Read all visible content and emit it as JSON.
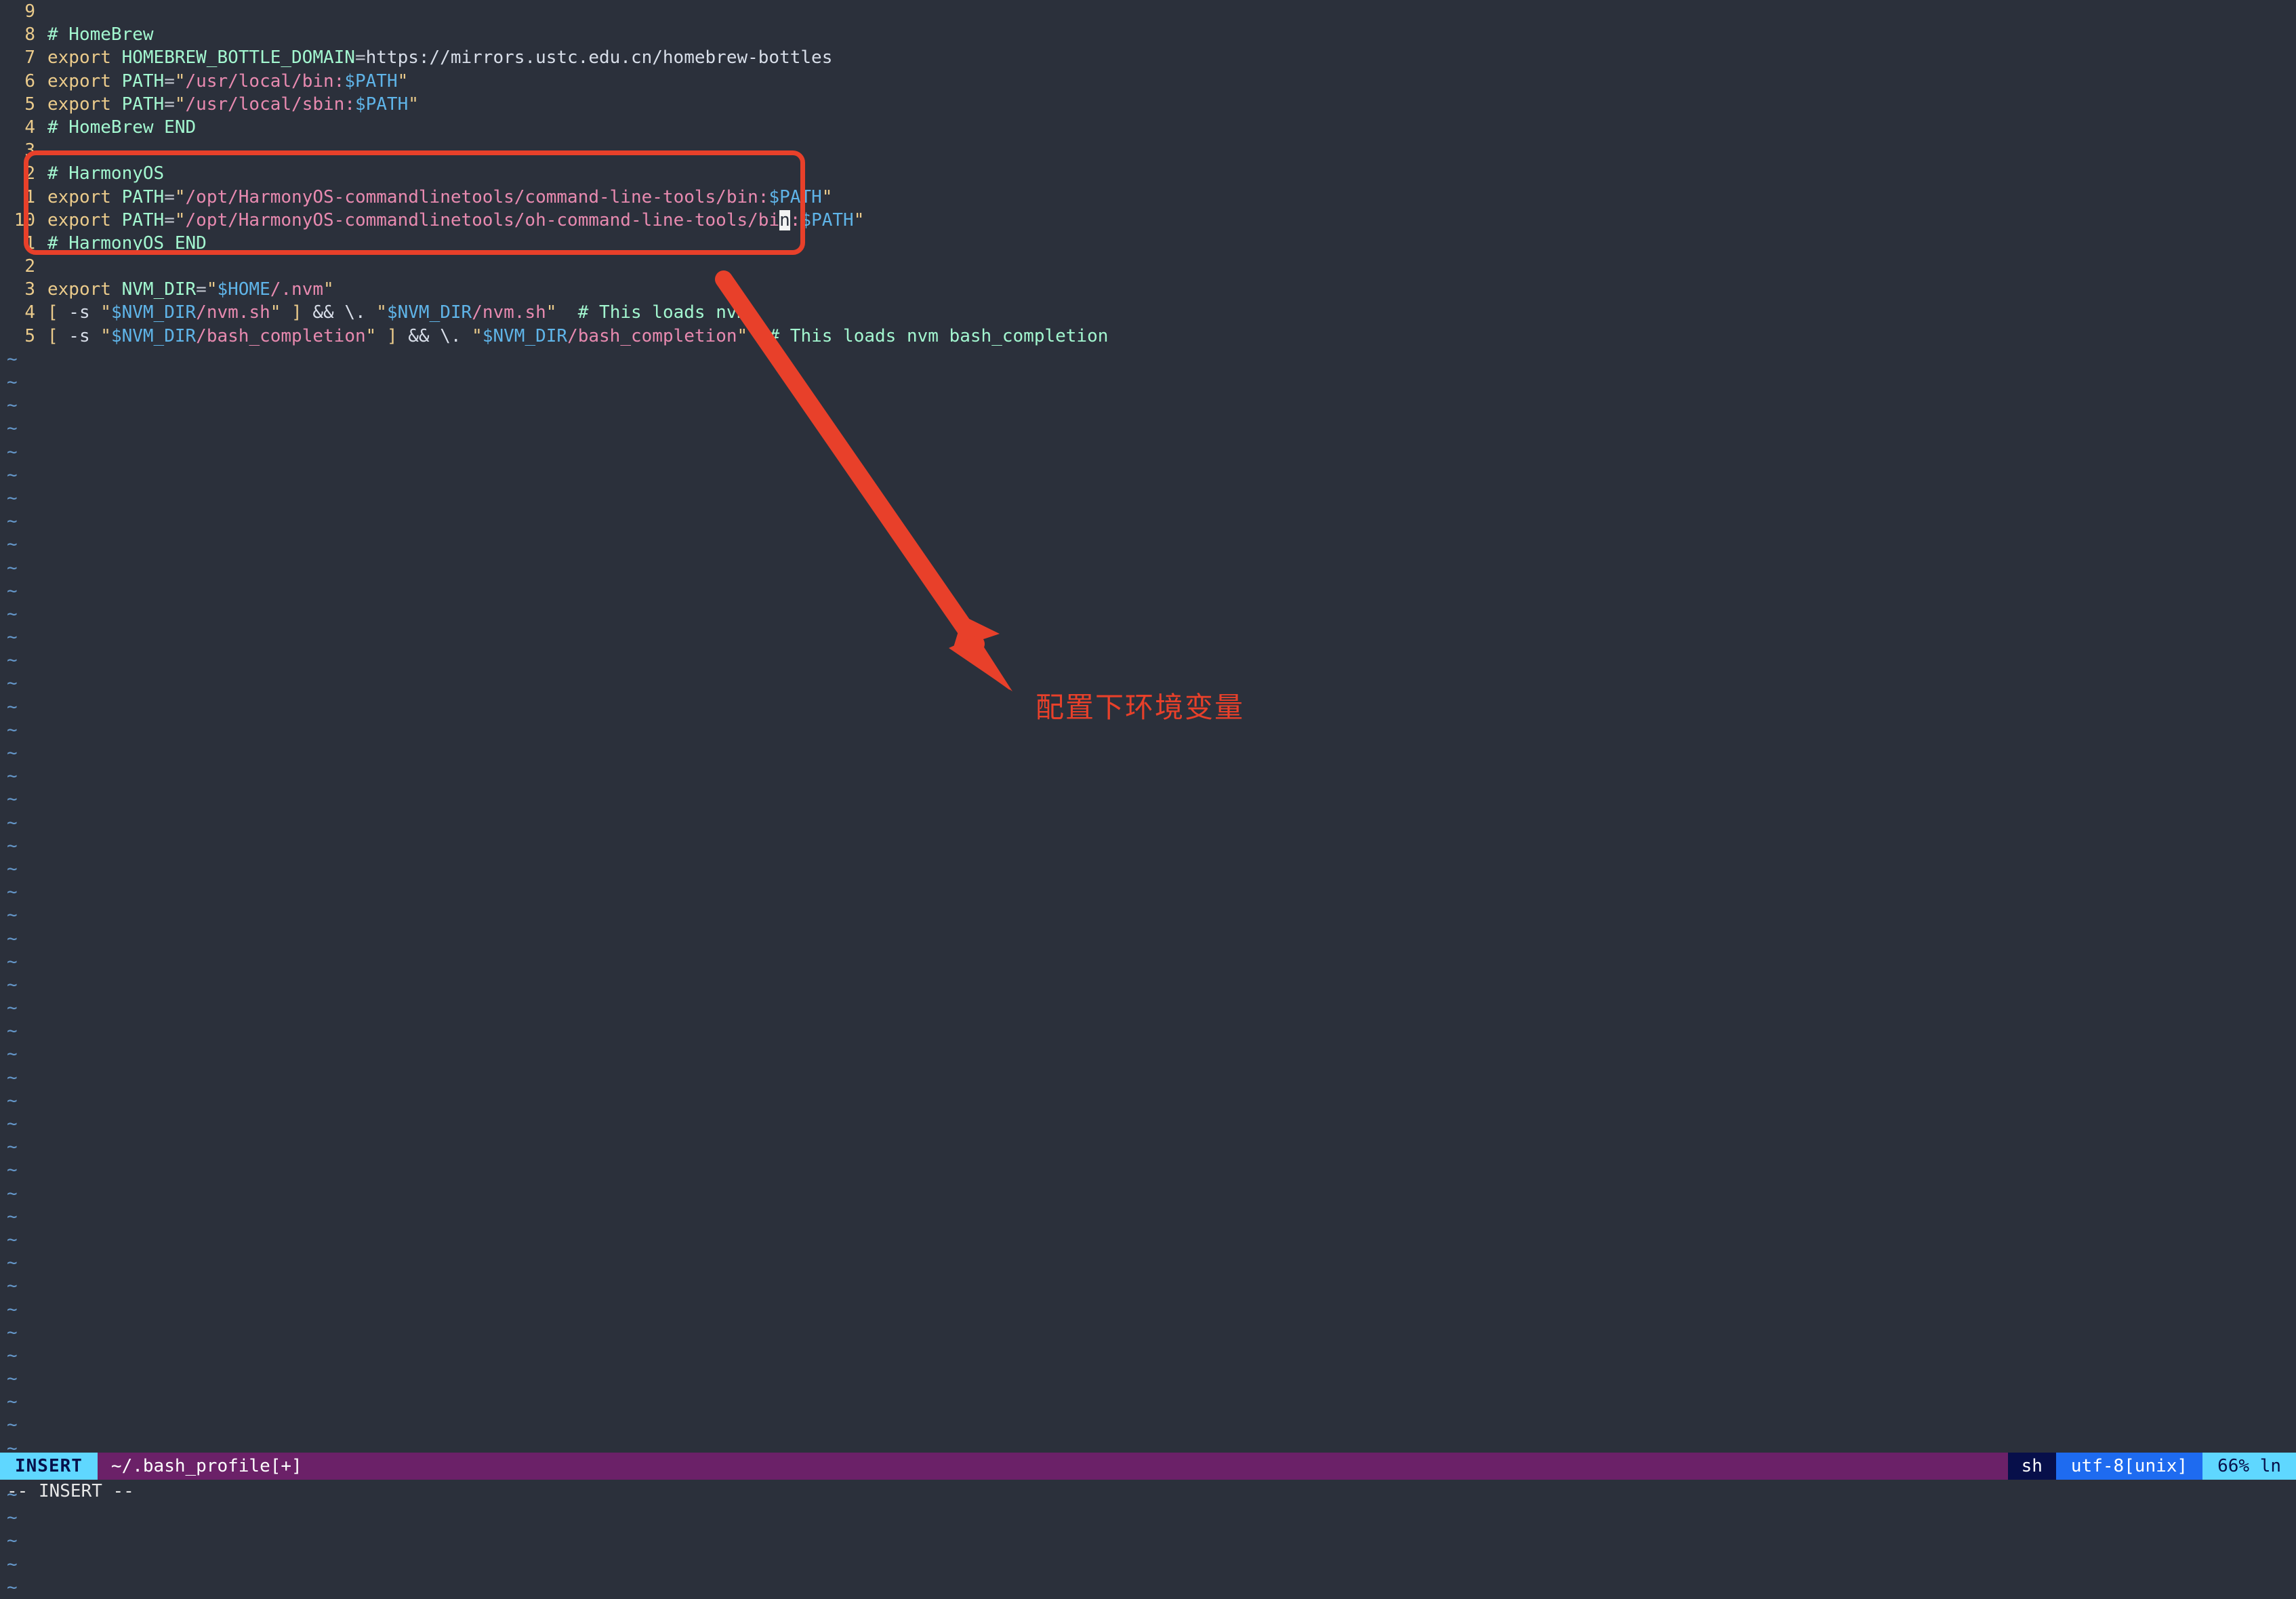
{
  "window": {
    "app": "vim",
    "background_color": "#2b303b"
  },
  "editor": {
    "lines": [
      {
        "num": "9",
        "current": false,
        "tokens": []
      },
      {
        "num": "8",
        "current": false,
        "tokens": [
          {
            "t": "cmt",
            "s": "# HomeBrew"
          }
        ]
      },
      {
        "num": "7",
        "current": false,
        "tokens": [
          {
            "t": "kw",
            "s": "export"
          },
          {
            "t": "plain",
            "s": " "
          },
          {
            "t": "var",
            "s": "HOMEBREW_BOTTLE_DOMAIN"
          },
          {
            "t": "op",
            "s": "="
          },
          {
            "t": "plain",
            "s": "https://mirrors.ustc.edu.cn/homebrew-bottles"
          }
        ]
      },
      {
        "num": "6",
        "current": false,
        "tokens": [
          {
            "t": "kw",
            "s": "export"
          },
          {
            "t": "plain",
            "s": " "
          },
          {
            "t": "var",
            "s": "PATH"
          },
          {
            "t": "op",
            "s": "="
          },
          {
            "t": "quote",
            "s": "\""
          },
          {
            "t": "str",
            "s": "/usr/local/bin:"
          },
          {
            "t": "env",
            "s": "$PATH"
          },
          {
            "t": "quote",
            "s": "\""
          }
        ]
      },
      {
        "num": "5",
        "current": false,
        "tokens": [
          {
            "t": "kw",
            "s": "export"
          },
          {
            "t": "plain",
            "s": " "
          },
          {
            "t": "var",
            "s": "PATH"
          },
          {
            "t": "op",
            "s": "="
          },
          {
            "t": "quote",
            "s": "\""
          },
          {
            "t": "str",
            "s": "/usr/local/sbin:"
          },
          {
            "t": "env",
            "s": "$PATH"
          },
          {
            "t": "quote",
            "s": "\""
          }
        ]
      },
      {
        "num": "4",
        "current": false,
        "tokens": [
          {
            "t": "cmt",
            "s": "# HomeBrew END"
          }
        ]
      },
      {
        "num": "3",
        "current": false,
        "tokens": []
      },
      {
        "num": "2",
        "current": false,
        "tokens": [
          {
            "t": "cmt",
            "s": "# HarmonyOS"
          }
        ]
      },
      {
        "num": "1",
        "current": false,
        "tokens": [
          {
            "t": "kw",
            "s": "export"
          },
          {
            "t": "plain",
            "s": " "
          },
          {
            "t": "var",
            "s": "PATH"
          },
          {
            "t": "op",
            "s": "="
          },
          {
            "t": "quote",
            "s": "\""
          },
          {
            "t": "str",
            "s": "/opt/HarmonyOS-commandlinetools/command-line-tools/bin:"
          },
          {
            "t": "env",
            "s": "$PATH"
          },
          {
            "t": "quote",
            "s": "\""
          }
        ]
      },
      {
        "num": "10",
        "current": true,
        "tokens": [
          {
            "t": "kw",
            "s": "export"
          },
          {
            "t": "plain",
            "s": " "
          },
          {
            "t": "var",
            "s": "PATH"
          },
          {
            "t": "op",
            "s": "="
          },
          {
            "t": "quote",
            "s": "\""
          },
          {
            "t": "str",
            "s": "/opt/HarmonyOS-commandlinetools/oh-command-line-tools/bi"
          },
          {
            "t": "cursor",
            "s": "n"
          },
          {
            "t": "str",
            "s": ":"
          },
          {
            "t": "env",
            "s": "$PATH"
          },
          {
            "t": "quote",
            "s": "\""
          }
        ]
      },
      {
        "num": "1",
        "current": false,
        "tokens": [
          {
            "t": "cmt",
            "s": "# HarmonyOS END"
          }
        ]
      },
      {
        "num": "2",
        "current": false,
        "tokens": []
      },
      {
        "num": "3",
        "current": false,
        "tokens": [
          {
            "t": "kw",
            "s": "export"
          },
          {
            "t": "plain",
            "s": " "
          },
          {
            "t": "var",
            "s": "NVM_DIR"
          },
          {
            "t": "op",
            "s": "="
          },
          {
            "t": "quote",
            "s": "\""
          },
          {
            "t": "env",
            "s": "$HOME"
          },
          {
            "t": "str",
            "s": "/.nvm"
          },
          {
            "t": "quote",
            "s": "\""
          }
        ]
      },
      {
        "num": "4",
        "current": false,
        "tokens": [
          {
            "t": "brk",
            "s": "["
          },
          {
            "t": "and",
            "s": " -s "
          },
          {
            "t": "quote",
            "s": "\""
          },
          {
            "t": "env",
            "s": "$NVM_DIR"
          },
          {
            "t": "str",
            "s": "/nvm.sh"
          },
          {
            "t": "quote",
            "s": "\""
          },
          {
            "t": "brk",
            "s": " ]"
          },
          {
            "t": "and",
            "s": " && \\. "
          },
          {
            "t": "quote",
            "s": "\""
          },
          {
            "t": "env",
            "s": "$NVM_DIR"
          },
          {
            "t": "str",
            "s": "/nvm.sh"
          },
          {
            "t": "quote",
            "s": "\""
          },
          {
            "t": "plain",
            "s": "  "
          },
          {
            "t": "cmt",
            "s": "# This loads nvm"
          }
        ]
      },
      {
        "num": "5",
        "current": false,
        "tokens": [
          {
            "t": "brk",
            "s": "["
          },
          {
            "t": "and",
            "s": " -s "
          },
          {
            "t": "quote",
            "s": "\""
          },
          {
            "t": "env",
            "s": "$NVM_DIR"
          },
          {
            "t": "str",
            "s": "/bash_completion"
          },
          {
            "t": "quote",
            "s": "\""
          },
          {
            "t": "brk",
            "s": " ]"
          },
          {
            "t": "and",
            "s": " && \\. "
          },
          {
            "t": "quote",
            "s": "\""
          },
          {
            "t": "env",
            "s": "$NVM_DIR"
          },
          {
            "t": "str",
            "s": "/bash_completion"
          },
          {
            "t": "quote",
            "s": "\""
          },
          {
            "t": "plain",
            "s": "  "
          },
          {
            "t": "cmt",
            "s": "# This loads nvm bash_completion"
          }
        ]
      }
    ],
    "empty_marker": "~",
    "empty_line_count": 54
  },
  "highlight_box": {
    "color": "#e8402a",
    "encloses": "HarmonyOS export PATH block (lines 3 through 1 / # HarmonyOS END)"
  },
  "annotation": {
    "text": "配置下环境变量",
    "color": "#e8402a",
    "arrow": "red-down-right-arrow"
  },
  "statusline": {
    "mode": "INSERT",
    "file": "~/.bash_profile[+]",
    "filetype": "sh",
    "encoding": "utf-8[unix]",
    "position": "66%  ln",
    "colors": {
      "mode_bg": "#5fd7ff",
      "mode_fg": "#07104a",
      "file_bg": "#6b2168",
      "filetype_bg": "#070f4a",
      "encoding_bg": "#1e6bf0",
      "position_bg": "#5fd7ff"
    }
  },
  "cmdline": {
    "text": "-- INSERT --"
  }
}
